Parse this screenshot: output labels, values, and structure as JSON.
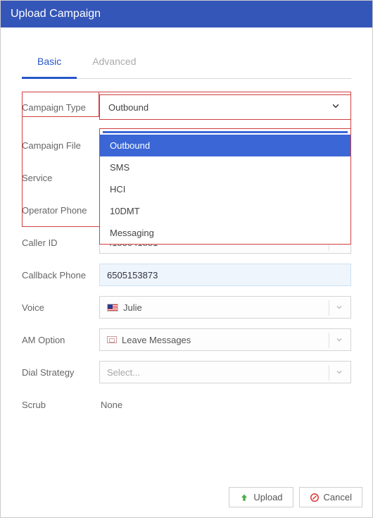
{
  "title": "Upload Campaign",
  "tabs": {
    "basic": "Basic",
    "advanced": "Advanced"
  },
  "labels": {
    "campaign_type": "Campaign Type",
    "campaign_file": "Campaign File",
    "service": "Service",
    "operator_phone": "Operator Phone",
    "caller_id": "Caller ID",
    "callback_phone": "Callback Phone",
    "voice": "Voice",
    "am_option": "AM Option",
    "dial_strategy": "Dial Strategy",
    "scrub": "Scrub"
  },
  "campaign_type": {
    "selected": "Outbound",
    "options": [
      "Outbound",
      "SMS",
      "HCI",
      "10DMT",
      "Messaging"
    ]
  },
  "caller_id": "4155041881",
  "callback_phone": "6505153873",
  "voice": {
    "label": "Julie"
  },
  "am_option": "Leave Messages",
  "dial_strategy_placeholder": "Select...",
  "scrub_value": "None",
  "buttons": {
    "upload": "Upload",
    "cancel": "Cancel"
  }
}
